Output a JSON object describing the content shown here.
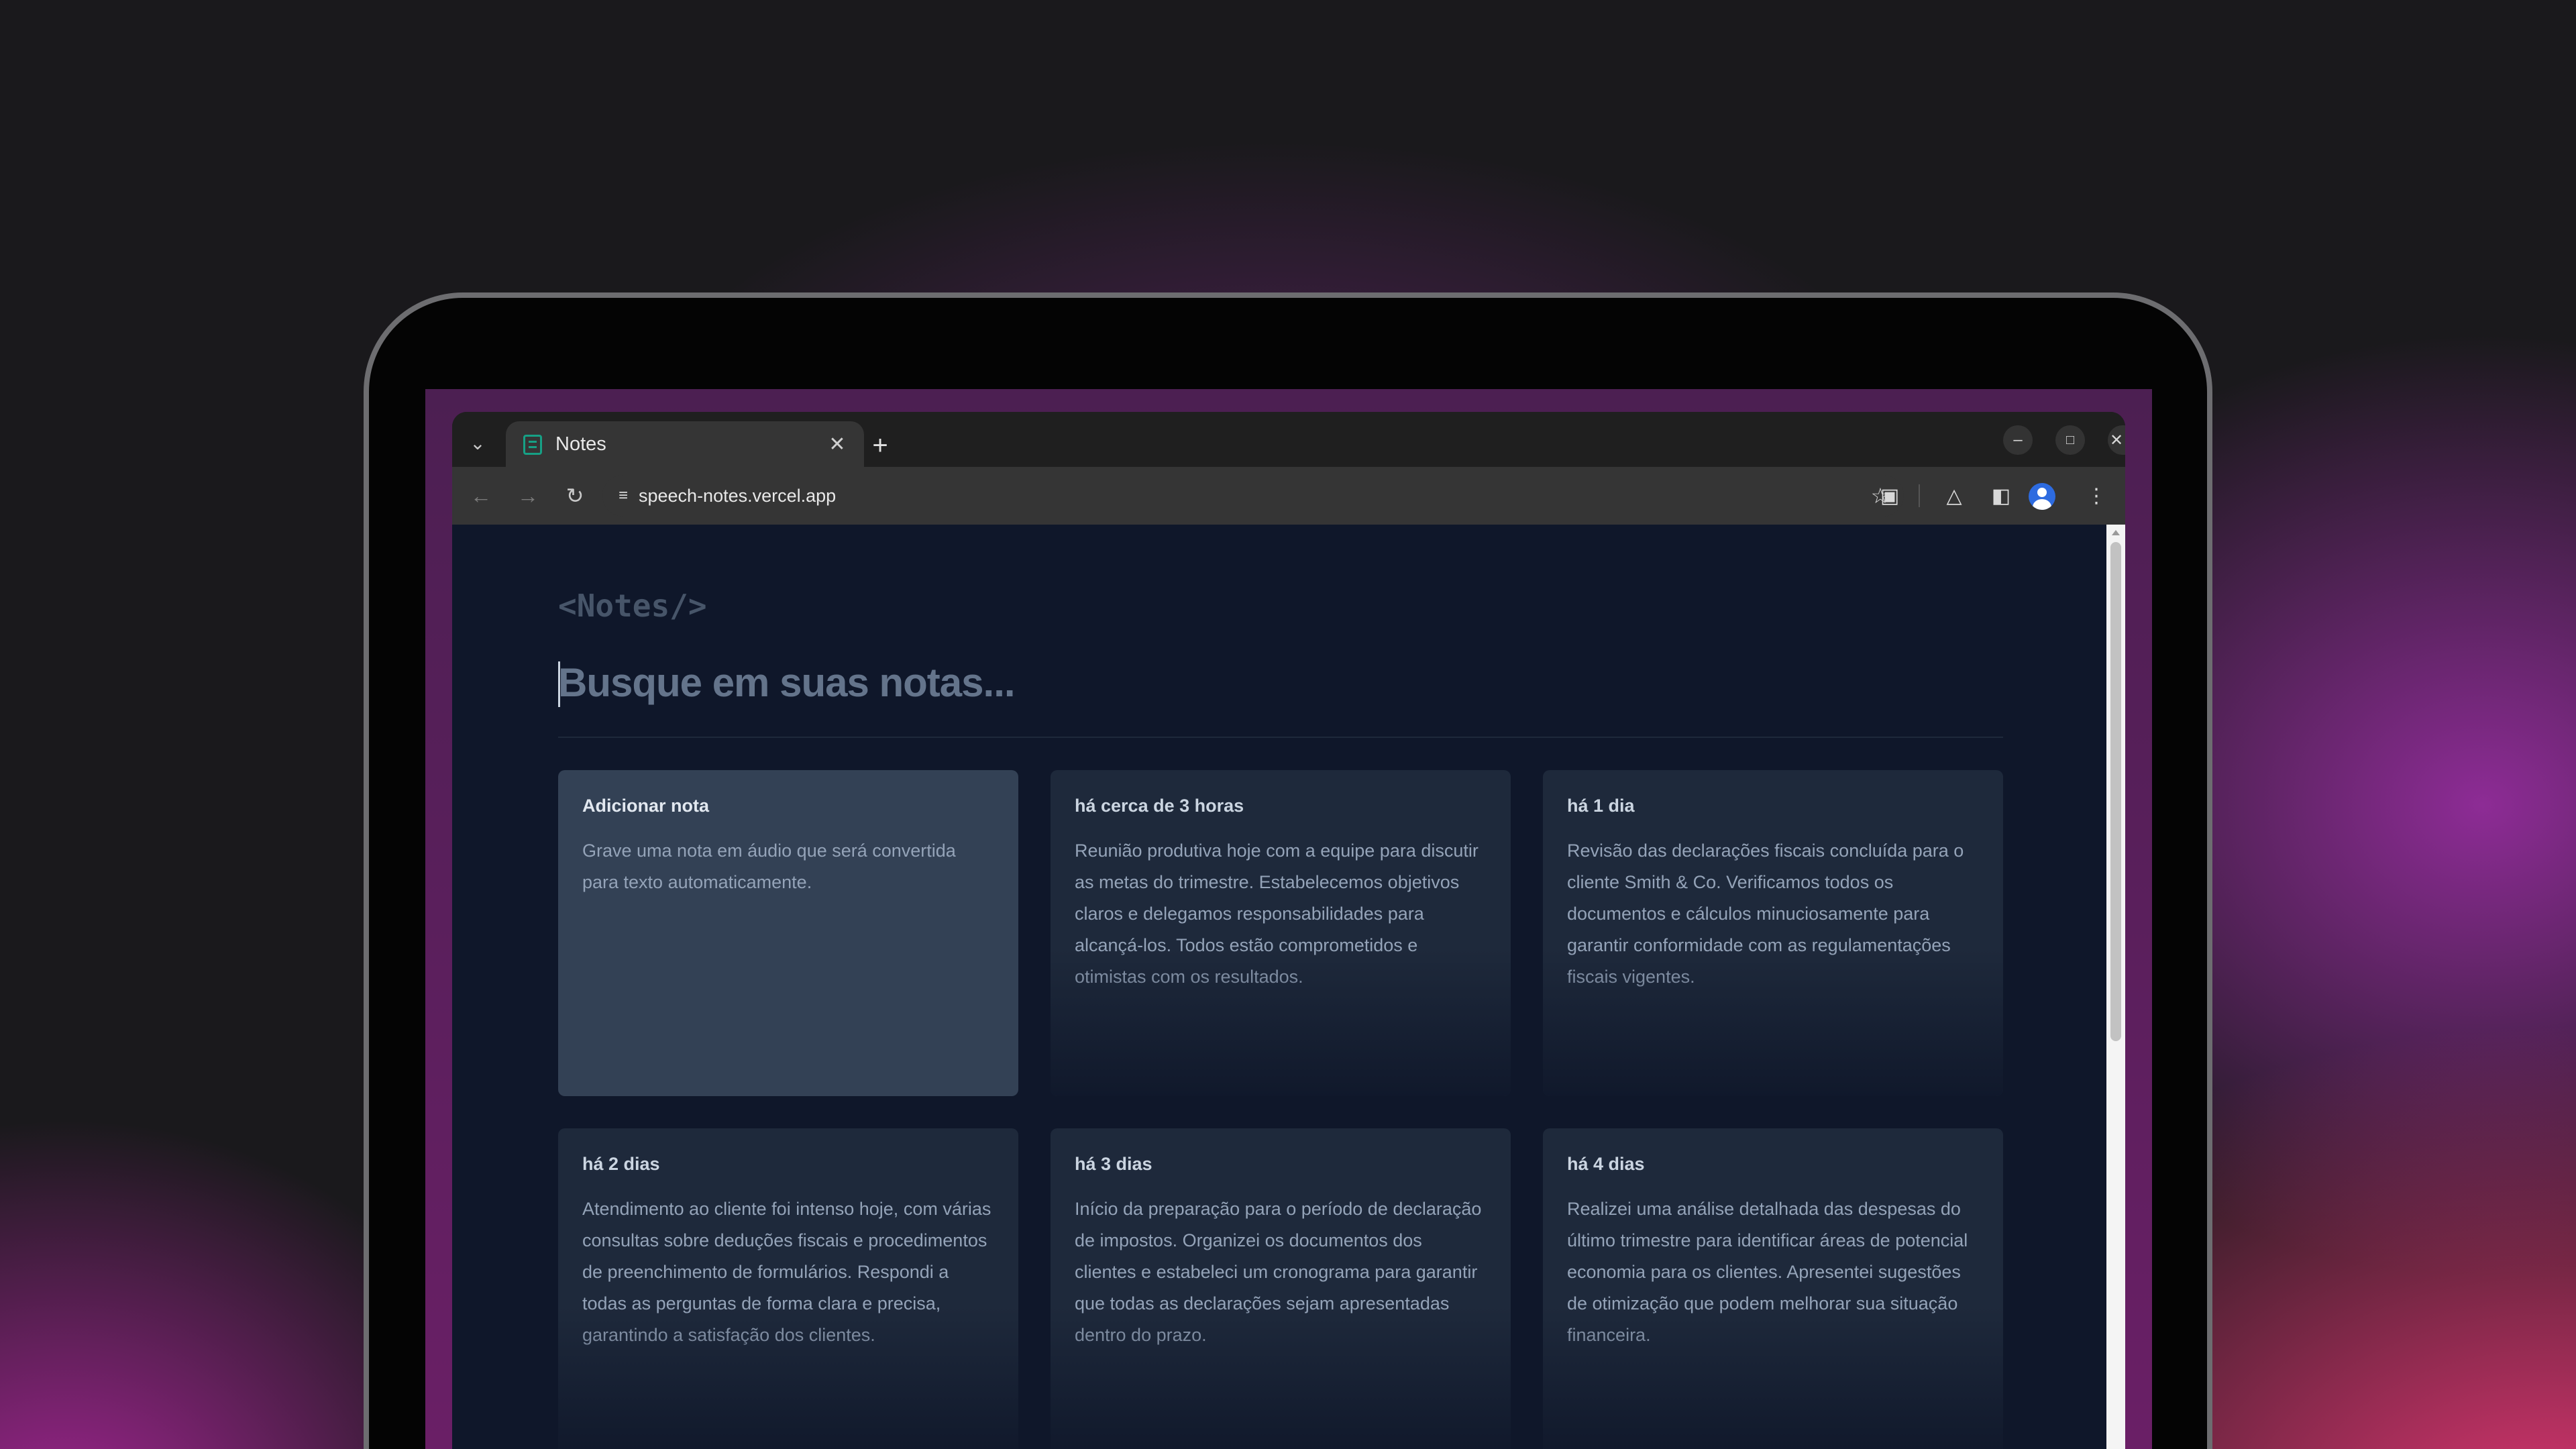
{
  "browser": {
    "tab_search_icon": "chevron-down-icon",
    "tab": {
      "title": "Notes",
      "favicon": "notes-icon",
      "close_icon": "close-icon"
    },
    "new_tab_icon": "plus-icon",
    "window_controls": [
      "minimize-icon",
      "maximize-icon",
      "close-icon"
    ],
    "toolbar": {
      "back_icon": "arrow-left-icon",
      "forward_icon": "arrow-right-icon",
      "reload_icon": "reload-icon",
      "site_info_icon": "tune-icon",
      "url": "speech-notes.vercel.app",
      "bookmark_icon": "star-icon",
      "extensions_icon": "puzzle-icon",
      "labs_icon": "flask-icon",
      "side_panel_icon": "side-panel-icon",
      "profile_icon": "avatar-icon",
      "menu_icon": "kebab-menu-icon"
    }
  },
  "page": {
    "logo": "<Notes/>",
    "search": {
      "placeholder": "Busque em suas notas...",
      "value": ""
    },
    "add_card": {
      "title": "Adicionar nota",
      "description": "Grave uma nota em áudio que será convertida para texto automaticamente."
    },
    "notes": [
      {
        "date": "há cerca de 3 horas",
        "content": "Reunião produtiva hoje com a equipe para discutir as metas do trimestre. Estabelecemos objetivos claros e delegamos responsabilidades para alcançá-los. Todos estão comprometidos e otimistas com os resultados."
      },
      {
        "date": "há 1 dia",
        "content": "Revisão das declarações fiscais concluída para o cliente Smith & Co. Verificamos todos os documentos e cálculos minuciosamente para garantir conformidade com as regulamentações fiscais vigentes."
      },
      {
        "date": "há 2 dias",
        "content": "Atendimento ao cliente foi intenso hoje, com várias consultas sobre deduções fiscais e procedimentos de preenchimento de formulários. Respondi a todas as perguntas de forma clara e precisa, garantindo a satisfação dos clientes."
      },
      {
        "date": "há 3 dias",
        "content": "Início da preparação para o período de declaração de impostos. Organizei os documentos dos clientes e estabeleci um cronograma para garantir que todas as declarações sejam apresentadas dentro do prazo."
      },
      {
        "date": "há 4 dias",
        "content": "Realizei uma análise detalhada das despesas do último trimestre para identificar áreas de potencial economia para os clientes. Apresentei sugestões de otimização que podem melhorar sua situação financeira."
      }
    ]
  },
  "colors": {
    "page_background": "#0f172a",
    "card_background": "#1e293b",
    "add_card_background": "#334155",
    "tab_accent": "#16a085"
  }
}
